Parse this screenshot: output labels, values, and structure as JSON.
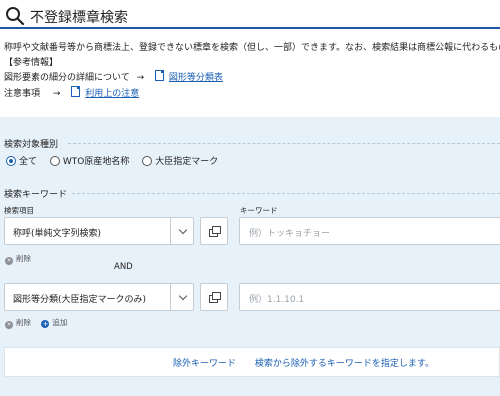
{
  "page": {
    "title": "不登録標章検索",
    "description": "称呼や文献番号等から商標法上、登録できない標章を検索（但し、一部）できます。なお、検索結果は商標公報に代わるもの",
    "reference_heading": "【参考情報】",
    "figure_info_label": "図形要素の細分の詳細について",
    "figure_info_link": "図形等分類表",
    "notes_label": "注意事項",
    "notes_link": "利用上の注意",
    "arrow": "→"
  },
  "search_target": {
    "label": "検索対象種別",
    "options": [
      "全て",
      "WTO原産地名称",
      "大臣指定マーク"
    ],
    "selected": "全て"
  },
  "keyword_section": {
    "label": "検索キーワード",
    "item_header": "検索項目",
    "keyword_header": "キーワード",
    "rows": [
      {
        "item": "称呼(単純文字列検索)",
        "placeholder": "例）トッキョチョー"
      },
      {
        "item": "図形等分類(大臣指定マークのみ)",
        "placeholder": "例）1.1.10.1"
      }
    ],
    "delete_label": "削除",
    "add_label": "追加",
    "operator": "AND"
  },
  "exclude": {
    "label": "除外キーワード",
    "hint": "検索から除外するキーワードを指定します。"
  },
  "colors": {
    "accent": "#1a5fb4",
    "title_rule": "#1c5aa8",
    "panel_bg": "#e7f1fa"
  }
}
